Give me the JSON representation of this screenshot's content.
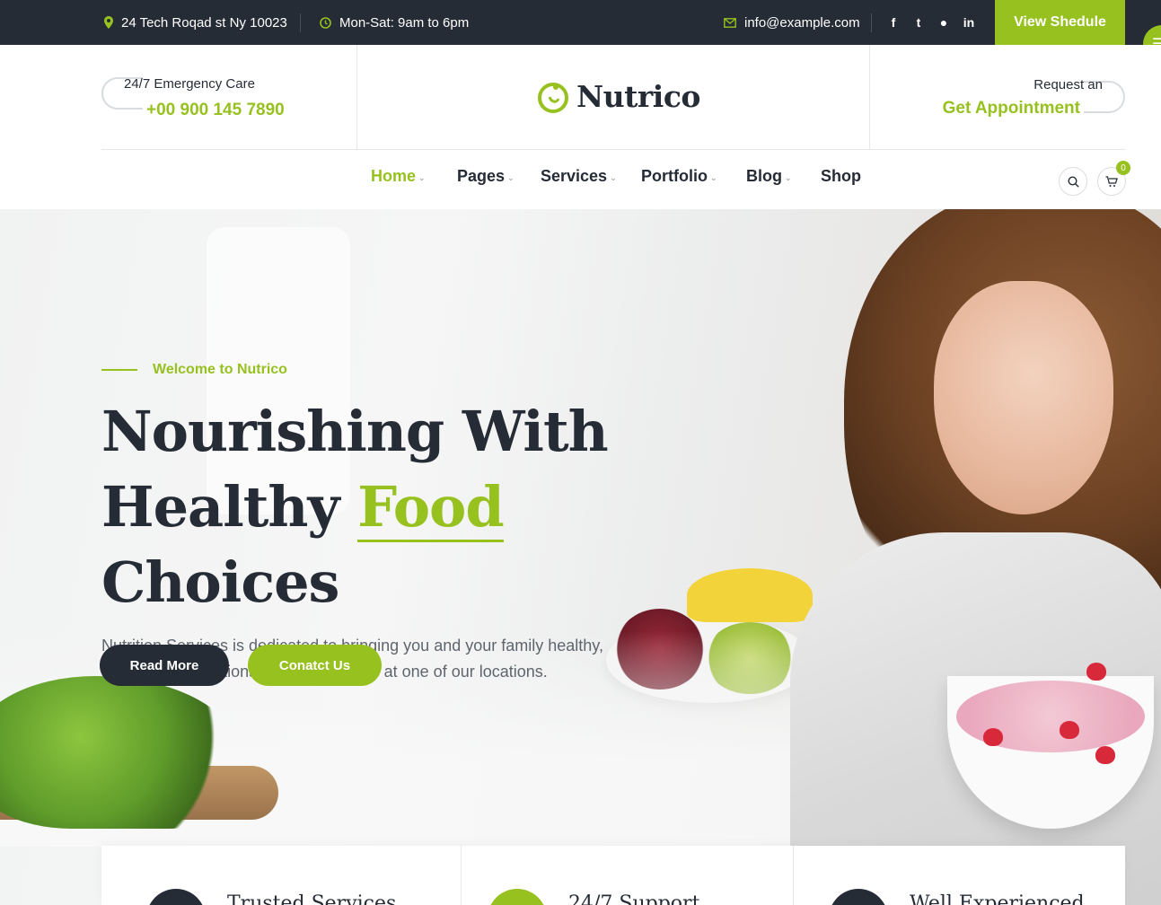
{
  "topbar": {
    "address": "24 Tech Roqad st Ny 10023",
    "hours": "Mon-Sat: 9am to 6pm",
    "email": "info@example.com",
    "social": [
      {
        "icon": "facebook-icon",
        "glyph": "f"
      },
      {
        "icon": "twitter-icon",
        "glyph": "t"
      },
      {
        "icon": "flickr-icon",
        "glyph": "●"
      },
      {
        "icon": "linkedin-icon",
        "glyph": "in"
      }
    ],
    "cta": "View Shedule"
  },
  "header": {
    "emergency_label": "24/7 Emergency Care",
    "emergency_phone": "+00 900 145 7890",
    "logo": "Nutrico",
    "appointment_label": "Request an",
    "appointment_cta": "Get Appointment"
  },
  "nav": {
    "items": [
      {
        "label": "Home",
        "active": true,
        "dropdown": true
      },
      {
        "label": "Pages",
        "active": false,
        "dropdown": true
      },
      {
        "label": "Services",
        "active": false,
        "dropdown": true
      },
      {
        "label": "Portfolio",
        "active": false,
        "dropdown": true
      },
      {
        "label": "Blog",
        "active": false,
        "dropdown": true
      },
      {
        "label": "Shop",
        "active": false,
        "dropdown": false
      }
    ],
    "cart_count": "0"
  },
  "hero": {
    "kicker": "Welcome to Nutrico",
    "headline_line1": "Nourishing With",
    "headline_pre": "Healthy ",
    "headline_accent": "Food",
    "headline_post": " Choices",
    "lead": "Nutrition Services is dedicated to bringing you and your family healthy, delicious food options whenever you're at one of our locations.",
    "btn_primary": "Read More",
    "btn_secondary": "Conatct Us"
  },
  "features": [
    {
      "title": "Trusted Services"
    },
    {
      "title": "24/7 Support"
    },
    {
      "title": "Well Experienced"
    }
  ],
  "colors": {
    "accent": "#97c11f",
    "dark": "#262c36"
  }
}
